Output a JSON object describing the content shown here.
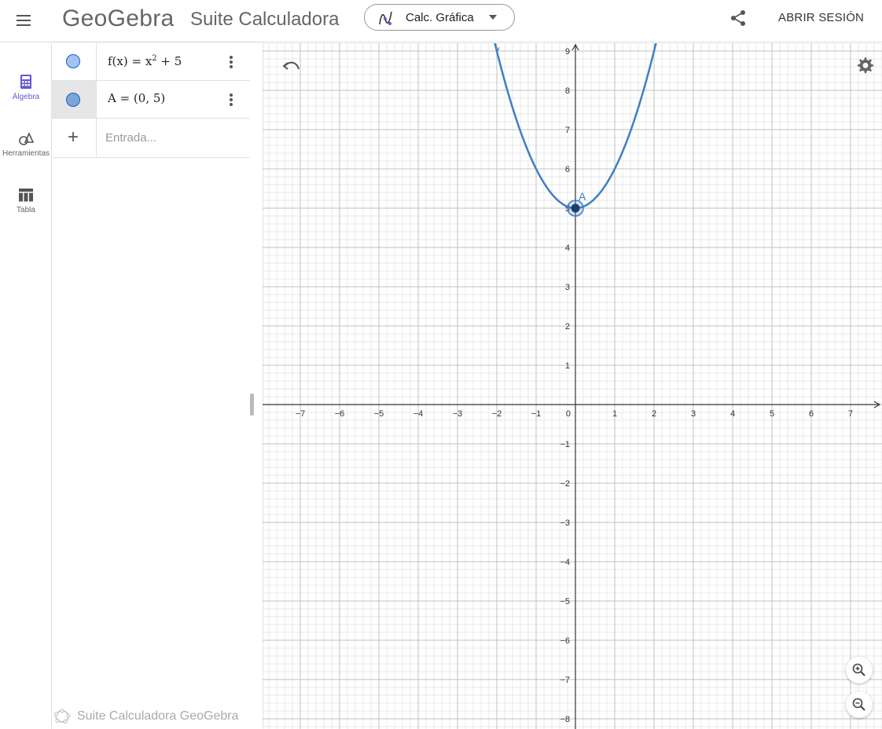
{
  "header": {
    "logo_text": "GeoGebra",
    "suite_title": "Suite Calculadora",
    "app_picker": {
      "label": "Calc. Gráfica",
      "icon": "graphing-icon"
    },
    "login_label": "ABRIR SESIÓN"
  },
  "sidebar": {
    "items": [
      {
        "label": "Álgebra",
        "icon": "calculator-icon",
        "active": true
      },
      {
        "label": "Herramientas",
        "icon": "tools-icon",
        "active": false
      },
      {
        "label": "Tabla",
        "icon": "table-icon",
        "active": false
      }
    ]
  },
  "algebra": {
    "rows": [
      {
        "expression_lhs": "f(x) = x",
        "exponent": "2",
        "expression_rhs": " + 5",
        "marble_color": "#a4c2f4"
      },
      {
        "expression": "A = (0, 5)",
        "marble_color": "#7ea4d9"
      }
    ],
    "input_placeholder": "Entrada...",
    "footer_brand": "Suite Calculadora GeoGebra"
  },
  "graphics": {
    "function_label": "f",
    "point_label": "A",
    "curve_color": "#3f7fc2",
    "x_range": [
      -7,
      7
    ],
    "y_range": [
      -8,
      9
    ],
    "x_tick_labels": [
      "−7",
      "−6",
      "−5",
      "−4",
      "−3",
      "−2",
      "−1",
      "0",
      "1",
      "2",
      "3",
      "4",
      "5",
      "6",
      "7"
    ],
    "y_tick_labels": [
      "9",
      "8",
      "7",
      "6",
      "5",
      "4",
      "3",
      "2",
      "1",
      "−1",
      "−2",
      "−3",
      "−4",
      "−5",
      "−6",
      "−7",
      "−8"
    ],
    "function": {
      "a": 1,
      "c": 5
    },
    "point": {
      "x": 0,
      "y": 5
    }
  },
  "colors": {
    "accent": "#6557d2",
    "grid_major": "#c0c0c0",
    "grid_minor": "#e8e8e8",
    "axis": "#333333"
  }
}
